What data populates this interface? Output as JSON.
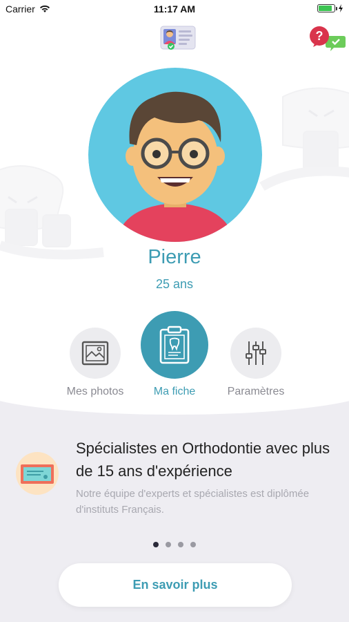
{
  "status_bar": {
    "carrier": "Carrier",
    "time": "11:17 AM"
  },
  "profile": {
    "name": "Pierre",
    "age": "25 ans"
  },
  "actions": [
    {
      "label": "Mes photos",
      "icon": "photo-icon",
      "active": false
    },
    {
      "label": "Ma fiche",
      "icon": "clipboard-tooth-icon",
      "active": true
    },
    {
      "label": "Paramètres",
      "icon": "sliders-icon",
      "active": false
    }
  ],
  "info_slide": {
    "title": "Spécialistes en Orthodontie avec plus de 15 ans d'expérience",
    "description": "Notre équipe d'experts et spécialistes est diplômée d'instituts Français."
  },
  "pagination": {
    "total": 4,
    "active_index": 0
  },
  "cta": {
    "label": "En savoir plus"
  },
  "colors": {
    "accent": "#3d9cb3",
    "avatar_bg": "#5fc8e2",
    "section_bg": "#eeedf2",
    "inactive_circle": "#ececef"
  }
}
